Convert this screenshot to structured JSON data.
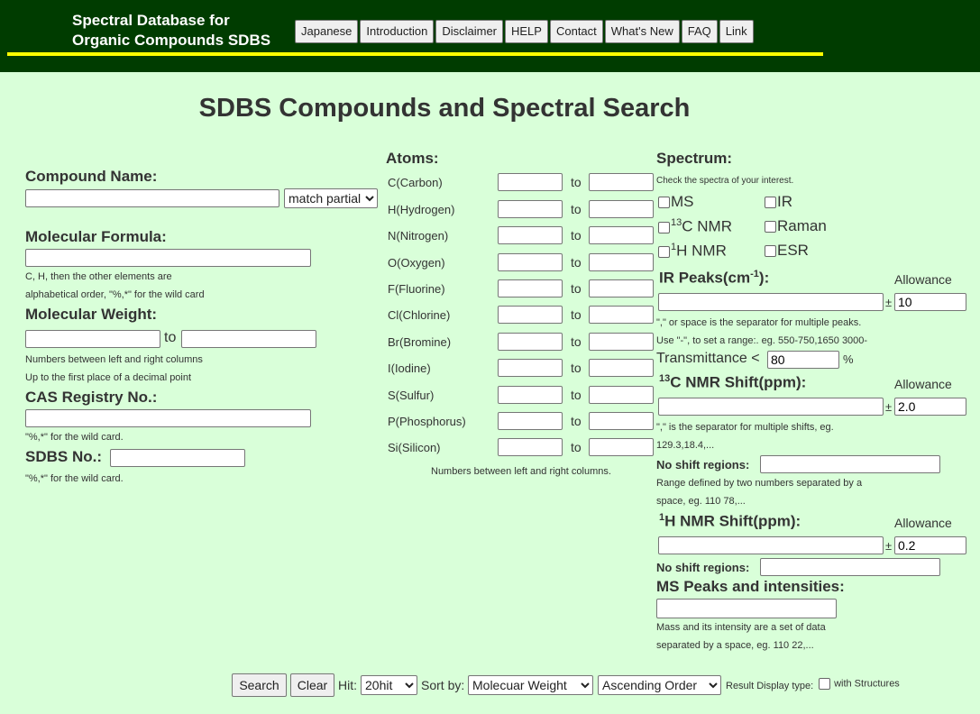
{
  "header": {
    "brand_line1": "Spectral Database for",
    "brand_line2": "Organic Compounds SDBS",
    "nav": [
      "Japanese",
      "Introduction",
      "Disclaimer",
      "HELP",
      "Contact",
      "What's New",
      "FAQ",
      "Link"
    ]
  },
  "title": "SDBS Compounds and Spectral Search",
  "left": {
    "compound_name": "Compound Name:",
    "match_select": "match partial",
    "formula": "Molecular Formula:",
    "formula_note1": "C, H, then the other elements are",
    "formula_note2": "alphabetical order, \"%,*\" for the wild card",
    "weight": "Molecular Weight:",
    "to": "to",
    "weight_note1": "Numbers between left and right columns",
    "weight_note2": "Up to the first place of a decimal point",
    "cas": "CAS Registry No.:",
    "cas_note": "\"%,*\" for the wild card.",
    "sdbs": "SDBS No.:",
    "sdbs_note": "\"%,*\" for the wild card."
  },
  "atoms": {
    "title": "Atoms:",
    "to": "to",
    "items": [
      "C(Carbon)",
      "H(Hydrogen)",
      "N(Nitrogen)",
      "O(Oxygen)",
      "F(Fluorine)",
      "Cl(Chlorine)",
      "Br(Bromine)",
      "I(Iodine)",
      "S(Sulfur)",
      "P(Phosphorus)",
      "Si(Silicon)"
    ],
    "note": "Numbers between left and right columns."
  },
  "spectrum": {
    "title": "Spectrum:",
    "note": "Check the spectra of your interest.",
    "checks": {
      "ms": "MS",
      "ir": "IR",
      "c13_sup": "13",
      "c13": "C NMR",
      "raman": "Raman",
      "h1_sup": "1",
      "h1": "H NMR",
      "esr": "ESR"
    },
    "ir_title": "IR Peaks(cm",
    "ir_sup": "-1",
    "ir_close": "):",
    "allowance": "Allowance",
    "pm": "±",
    "ir_allow": "10",
    "ir_note1": "\",\" or space is the separator for multiple peaks.",
    "ir_note2": "Use \"-\", to set a range:. eg. 550-750,1650 3000-",
    "transmittance": "Transmittance <",
    "trans_value": "80",
    "percent": "%",
    "c13_sup": "13",
    "c13_title": "C NMR Shift(ppm):",
    "c13_allow": "2.0",
    "c13_note1": "\",\" is the separator for multiple shifts, eg.",
    "c13_note2": "129.3,18.4,...",
    "no_shift": "No shift regions:",
    "range_note1": "Range defined by two numbers separated by a",
    "range_note2": "space, eg. 110 78,...",
    "h1_sup": "1",
    "h1_title": "H NMR Shift(ppm):",
    "h1_allow": "0.2",
    "ms_title": "MS Peaks and intensities:",
    "ms_note1": "Mass and its intensity are a set of data",
    "ms_note2": "separated by a space, eg. 110 22,..."
  },
  "bottom": {
    "search": "Search",
    "clear": "Clear",
    "hit": "Hit:",
    "hit_value": "20hit",
    "sort_by": "Sort by:",
    "sort_value": "Molecuar Weight",
    "order_value": "Ascending Order",
    "display_type": "Result Display type:",
    "with_structures": "with Structures"
  }
}
